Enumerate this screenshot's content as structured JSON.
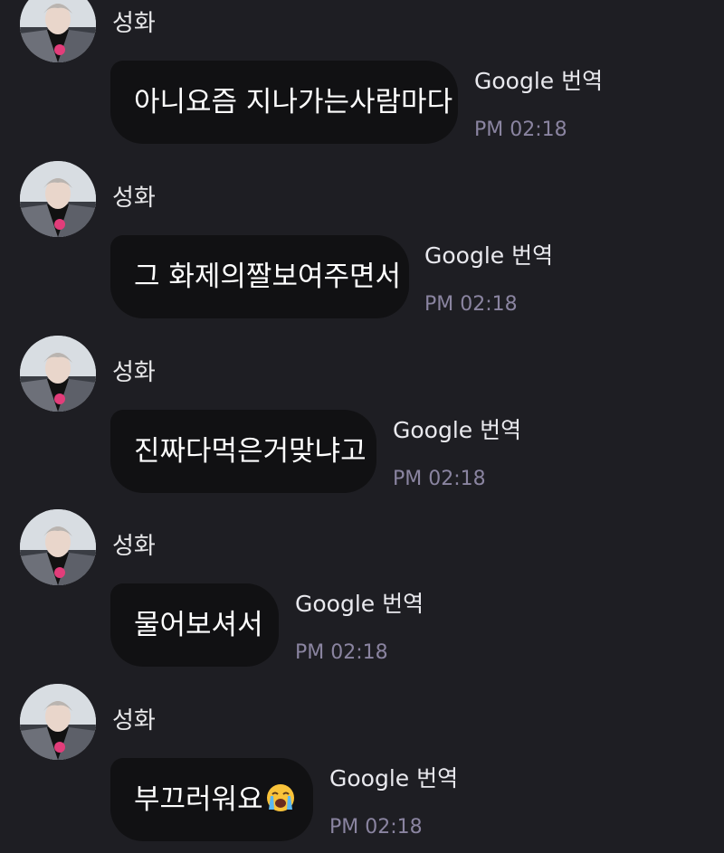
{
  "chat": {
    "messages": [
      {
        "sender": "성화",
        "text": "아니요즘 지나가는사람마다",
        "emoji": "",
        "translate_label": "Google 번역",
        "time": "PM 02:18"
      },
      {
        "sender": "성화",
        "text": "그 화제의짤보여주면서",
        "emoji": "",
        "translate_label": "Google 번역",
        "time": "PM 02:18"
      },
      {
        "sender": "성화",
        "text": "진짜다먹은거맞냐고",
        "emoji": "",
        "translate_label": "Google 번역",
        "time": "PM 02:18"
      },
      {
        "sender": "성화",
        "text": "물어보셔서",
        "emoji": "",
        "translate_label": "Google 번역",
        "time": "PM 02:18"
      },
      {
        "sender": "성화",
        "text": "부끄러워요",
        "emoji": "loudly-crying-face-icon",
        "translate_label": "Google 번역",
        "time": "PM 02:18"
      }
    ]
  }
}
